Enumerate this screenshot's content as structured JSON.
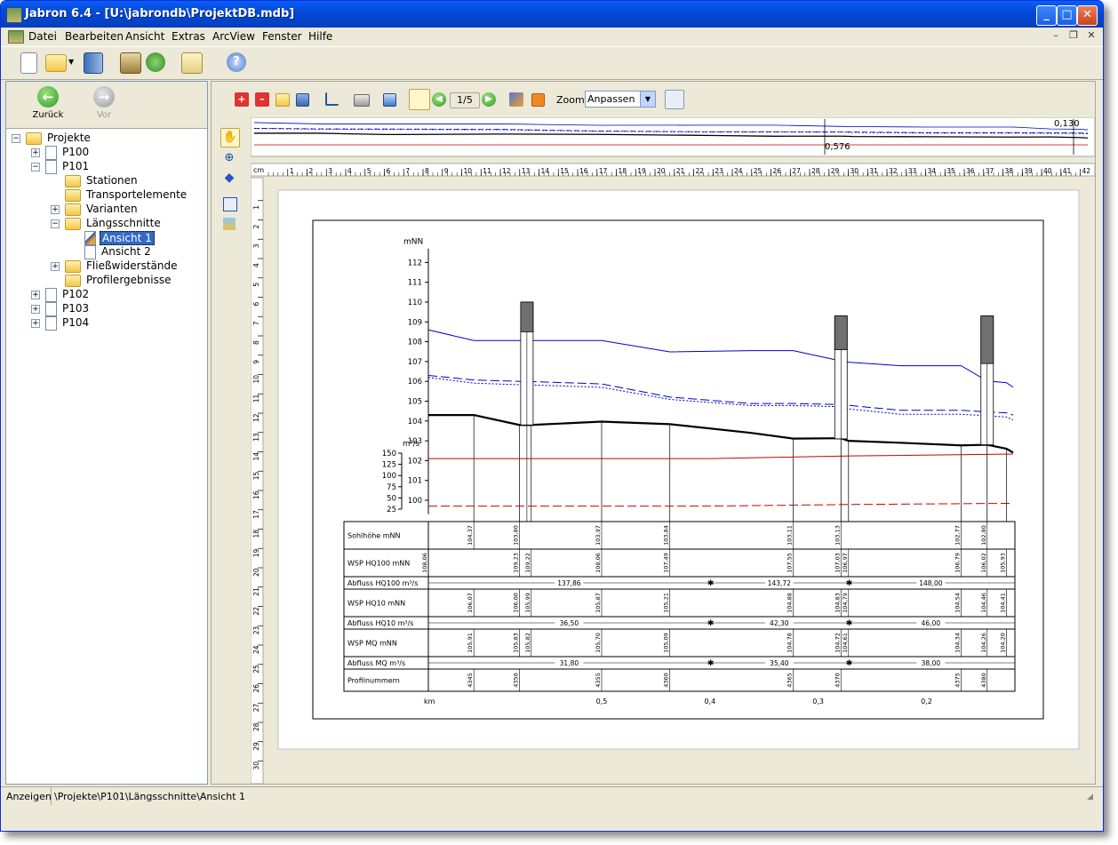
{
  "window": {
    "title": "Jabron 6.4 - [U:\\jabrondb\\ProjektDB.mdb]"
  },
  "menu": {
    "items": [
      "Datei",
      "Bearbeiten",
      "Ansicht",
      "Extras",
      "ArcView",
      "Fenster",
      "Hilfe"
    ]
  },
  "nav": {
    "back": "Zurück",
    "forward": "Vor"
  },
  "tree": [
    {
      "label": "Projekte",
      "level": 0,
      "exp": "-",
      "icon": "folder"
    },
    {
      "label": "P100",
      "level": 1,
      "exp": "+",
      "icon": "doc"
    },
    {
      "label": "P101",
      "level": 1,
      "exp": "-",
      "icon": "doc"
    },
    {
      "label": "Stationen",
      "level": 2,
      "exp": "",
      "icon": "folder"
    },
    {
      "label": "Transportelemente",
      "level": 2,
      "exp": "",
      "icon": "folder"
    },
    {
      "label": "Varianten",
      "level": 2,
      "exp": "+",
      "icon": "folder"
    },
    {
      "label": "Längsschnitte",
      "level": 2,
      "exp": "-",
      "icon": "folder"
    },
    {
      "label": "Ansicht 1",
      "level": 3,
      "exp": "",
      "icon": "view",
      "selected": true
    },
    {
      "label": "Ansicht 2",
      "level": 3,
      "exp": "",
      "icon": "doc"
    },
    {
      "label": "Fließwiderstände",
      "level": 2,
      "exp": "+",
      "icon": "folder"
    },
    {
      "label": "Profilergebnisse",
      "level": 2,
      "exp": "",
      "icon": "folder"
    },
    {
      "label": "P102",
      "level": 1,
      "exp": "+",
      "icon": "doc"
    },
    {
      "label": "P103",
      "level": 1,
      "exp": "+",
      "icon": "doc"
    },
    {
      "label": "P104",
      "level": 1,
      "exp": "+",
      "icon": "doc"
    }
  ],
  "viewer": {
    "page": "1/5",
    "zoom_label": "Zoom",
    "zoom_value": "Anpassen",
    "ruler_unit": "cm",
    "overview_top": "0,130",
    "overview_bottom": "0,576"
  },
  "chart_data": {
    "type": "line",
    "ylabel": "mNN",
    "ylim": [
      99,
      113
    ],
    "yticks": [
      100,
      101,
      102,
      103,
      104,
      105,
      106,
      107,
      108,
      109,
      110,
      111,
      112
    ],
    "y2label": "m³/s",
    "y2ticks": [
      25,
      50,
      75,
      100,
      125,
      150
    ],
    "xlabel": "km",
    "xlim": [
      0.66,
      0.12
    ],
    "xticks": [
      {
        "value": 0.5,
        "label": "0,5"
      },
      {
        "value": 0.4,
        "label": "0,4"
      },
      {
        "value": 0.3,
        "label": "0,3"
      },
      {
        "value": 0.2,
        "label": "0,2"
      }
    ],
    "x": [
      0.66,
      0.618,
      0.576,
      0.565,
      0.5,
      0.437,
      0.362,
      0.323,
      0.279,
      0.272,
      0.224,
      0.168,
      0.144,
      0.126,
      0.12
    ],
    "series": [
      {
        "name": "Sohlhöhe",
        "values": [
          104.3,
          104.3,
          103.8,
          103.8,
          103.97,
          103.84,
          103.4,
          103.11,
          103.13,
          103.0,
          102.9,
          102.77,
          102.8,
          102.6,
          102.4
        ],
        "color": "#000000",
        "style": "solid-thick"
      },
      {
        "name": "WSP HQ100",
        "values": [
          108.6,
          108.06,
          108.06,
          108.06,
          108.06,
          107.49,
          107.55,
          107.55,
          107.03,
          106.97,
          106.79,
          106.79,
          106.02,
          105.93,
          105.7
        ],
        "color": "#0000cc",
        "style": "solid"
      },
      {
        "name": "WSP HQ10",
        "values": [
          106.3,
          106.07,
          106.0,
          105.99,
          105.87,
          105.21,
          104.88,
          104.88,
          104.83,
          104.79,
          104.54,
          104.54,
          104.46,
          104.41,
          104.3
        ],
        "color": "#0000cc",
        "style": "dashed"
      },
      {
        "name": "WSP MQ",
        "values": [
          106.2,
          105.91,
          105.83,
          105.82,
          105.7,
          105.09,
          104.78,
          104.78,
          104.72,
          104.61,
          104.34,
          104.34,
          104.26,
          104.2,
          104.05
        ],
        "color": "#0000cc",
        "style": "dotted"
      }
    ],
    "discharge_series": [
      {
        "name": "Abfluss HQ100",
        "values": [
          137.86,
          137.86,
          143.72,
          148.0
        ],
        "color": "#cc0000",
        "style": "solid"
      },
      {
        "name": "Abfluss MQ",
        "values": [
          31.8,
          31.8,
          35.4,
          38.0
        ],
        "color": "#cc0000",
        "style": "dashed"
      }
    ],
    "structures": [
      {
        "x": 0.569,
        "top": 110.0,
        "shade_to": 108.5,
        "bottom": 103.8
      },
      {
        "x": 0.279,
        "top": 109.3,
        "shade_to": 107.6,
        "bottom": 103.1
      },
      {
        "x": 0.144,
        "top": 109.3,
        "shade_to": 106.9,
        "bottom": 102.8
      }
    ],
    "table": {
      "rows": [
        {
          "label": "Sohlhöhe",
          "unit": "mNN",
          "values": [
            {
              "x": 0.618,
              "v": "104,37"
            },
            {
              "x": 0.576,
              "v": "103,80"
            },
            {
              "x": 0.5,
              "v": "103,97"
            },
            {
              "x": 0.437,
              "v": "103,84"
            },
            {
              "x": 0.323,
              "v": "103,11"
            },
            {
              "x": 0.279,
              "v": "103,13"
            },
            {
              "x": 0.168,
              "v": "102,77"
            },
            {
              "x": 0.144,
              "v": "102,80"
            }
          ]
        },
        {
          "label": "WSP HQ100",
          "unit": "mNN",
          "values": [
            {
              "x": 0.66,
              "v": "108,06"
            },
            {
              "x": 0.576,
              "v": "109,23"
            },
            {
              "x": 0.565,
              "v": "109,22"
            },
            {
              "x": 0.5,
              "v": "108,06"
            },
            {
              "x": 0.437,
              "v": "107,49"
            },
            {
              "x": 0.323,
              "v": "107,55"
            },
            {
              "x": 0.279,
              "v": "107,03"
            },
            {
              "x": 0.272,
              "v": "106,97"
            },
            {
              "x": 0.168,
              "v": "106,79"
            },
            {
              "x": 0.144,
              "v": "106,02"
            },
            {
              "x": 0.126,
              "v": "105,93"
            }
          ]
        },
        {
          "label": "Abfluss HQ100",
          "unit": "m³/s",
          "segments": [
            "137,86",
            "143,72",
            "148,00"
          ]
        },
        {
          "label": "WSP HQ10",
          "unit": "mNN",
          "values": [
            {
              "x": 0.618,
              "v": "106,07"
            },
            {
              "x": 0.576,
              "v": "106,00"
            },
            {
              "x": 0.565,
              "v": "105,99"
            },
            {
              "x": 0.5,
              "v": "105,87"
            },
            {
              "x": 0.437,
              "v": "105,21"
            },
            {
              "x": 0.323,
              "v": "104,88"
            },
            {
              "x": 0.279,
              "v": "104,83"
            },
            {
              "x": 0.272,
              "v": "104,79"
            },
            {
              "x": 0.168,
              "v": "104,54"
            },
            {
              "x": 0.144,
              "v": "104,46"
            },
            {
              "x": 0.126,
              "v": "104,41"
            }
          ]
        },
        {
          "label": "Abfluss HQ10",
          "unit": "m³/s",
          "segments": [
            "36,50",
            "42,30",
            "46,00"
          ]
        },
        {
          "label": "WSP MQ",
          "unit": "mNN",
          "values": [
            {
              "x": 0.618,
              "v": "105,91"
            },
            {
              "x": 0.576,
              "v": "105,83"
            },
            {
              "x": 0.565,
              "v": "105,82"
            },
            {
              "x": 0.5,
              "v": "105,70"
            },
            {
              "x": 0.437,
              "v": "105,09"
            },
            {
              "x": 0.323,
              "v": "104,78"
            },
            {
              "x": 0.279,
              "v": "104,72"
            },
            {
              "x": 0.272,
              "v": "104,61"
            },
            {
              "x": 0.168,
              "v": "104,34"
            },
            {
              "x": 0.144,
              "v": "104,26"
            },
            {
              "x": 0.126,
              "v": "104,20"
            }
          ]
        },
        {
          "label": "Abfluss MQ",
          "unit": "m³/s",
          "segments": [
            "31,80",
            "35,40",
            "38,00"
          ]
        },
        {
          "label": "Profilnummern",
          "unit": "",
          "values": [
            {
              "x": 0.618,
              "v": "4345"
            },
            {
              "x": 0.576,
              "v": "4350"
            },
            {
              "x": 0.5,
              "v": "4355"
            },
            {
              "x": 0.437,
              "v": "4360"
            },
            {
              "x": 0.323,
              "v": "4365"
            },
            {
              "x": 0.279,
              "v": "4370"
            },
            {
              "x": 0.168,
              "v": "4375"
            },
            {
              "x": 0.144,
              "v": "4380"
            }
          ]
        }
      ]
    }
  },
  "status": {
    "left": "Anzeigen",
    "path": "\\Projekte\\P101\\Längsschnitte\\Ansicht 1"
  }
}
